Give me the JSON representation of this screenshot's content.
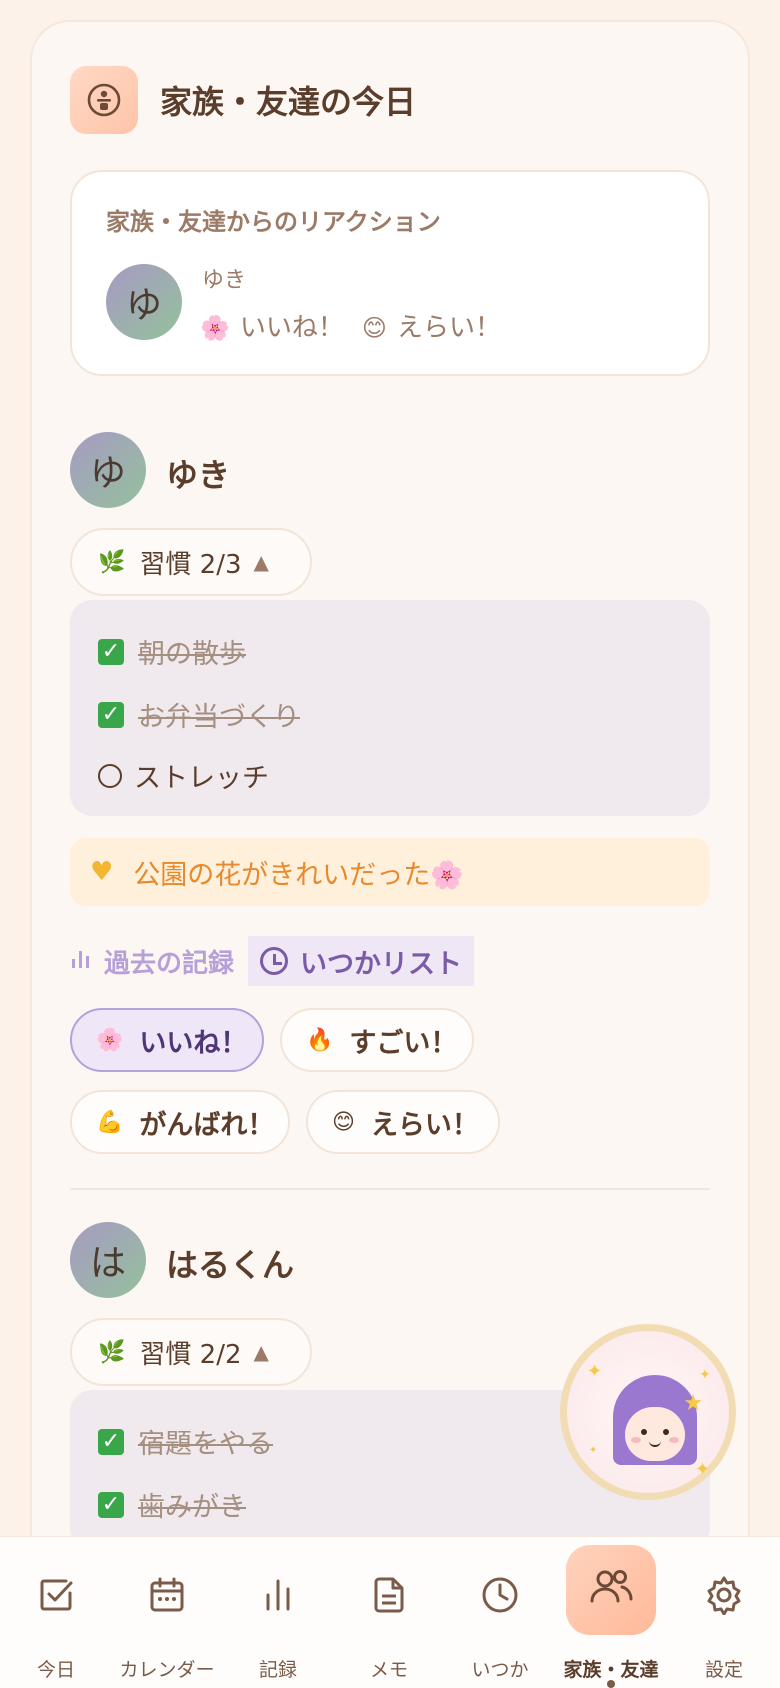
{
  "header": {
    "title": "家族・友達の今日",
    "icon": "family-smile-icon"
  },
  "reactions_card": {
    "title": "家族・友達からのリアクション",
    "avatar_initial": "ゆ",
    "name": "ゆき",
    "items": [
      {
        "emoji": "🌸",
        "label": "いいね！"
      },
      {
        "emoji": "😊",
        "label": "えらい！"
      }
    ]
  },
  "members": [
    {
      "initial": "ゆ",
      "name": "ゆき",
      "habit_summary": "習慣 2/3",
      "habits": [
        {
          "label": "朝の散歩",
          "done": true
        },
        {
          "label": "お弁当づくり",
          "done": true
        },
        {
          "label": "ストレッチ",
          "done": false
        }
      ],
      "memo": "公園の花がきれいだった🌸",
      "links": {
        "past": "過去の記録",
        "someday": "いつかリスト"
      },
      "reaction_buttons": [
        {
          "emoji": "🌸",
          "label": "いいね！",
          "active": true
        },
        {
          "emoji": "🔥",
          "label": "すごい！",
          "active": false
        },
        {
          "emoji": "💪",
          "label": "がんばれ！",
          "active": false
        },
        {
          "emoji": "😊",
          "label": "えらい！",
          "active": false
        }
      ]
    },
    {
      "initial": "は",
      "name": "はるくん",
      "habit_summary": "習慣 2/2",
      "habits": [
        {
          "label": "宿題をやる",
          "done": true
        },
        {
          "label": "歯みがき",
          "done": true
        }
      ]
    }
  ],
  "bottom_nav": [
    {
      "label": "今日",
      "icon": "checkbox-icon",
      "active": false
    },
    {
      "label": "カレンダー",
      "icon": "calendar-icon",
      "active": false
    },
    {
      "label": "記録",
      "icon": "bar-chart-icon",
      "active": false
    },
    {
      "label": "メモ",
      "icon": "document-icon",
      "active": false
    },
    {
      "label": "いつか",
      "icon": "clock-icon",
      "active": false
    },
    {
      "label": "家族・友達",
      "icon": "people-icon",
      "active": true
    },
    {
      "label": "設定",
      "icon": "gear-icon",
      "active": false
    }
  ],
  "colors": {
    "accent": "#ffb99a",
    "text": "#5a3d2b",
    "memo": "#e7892c",
    "purple": "#7a5ba8"
  }
}
